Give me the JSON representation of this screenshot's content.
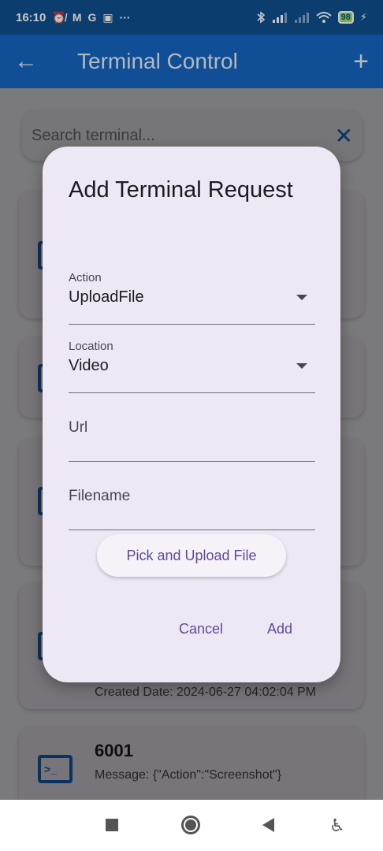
{
  "status_bar": {
    "time": "16:10",
    "left_icons": [
      "alarm-off-icon",
      "gmail-icon",
      "google-icon",
      "usb-icon",
      "more-icon"
    ],
    "left_glyphs": [
      "⏰̸",
      "M",
      "G",
      "▣",
      "···"
    ],
    "right_icons": [
      "bluetooth-icon",
      "signal-icon",
      "signal-icon",
      "wifi-icon",
      "battery-icon",
      "charging-icon"
    ],
    "battery": "98"
  },
  "app_bar": {
    "title": "Terminal Control",
    "back_icon": "back-arrow-icon",
    "add_icon": "add-icon"
  },
  "search": {
    "placeholder": "Search terminal...",
    "clear_icon": "close-icon"
  },
  "cards": [
    {
      "name": "",
      "line1": "",
      "line2": ""
    },
    {
      "name": "",
      "line1": "",
      "line2": ""
    },
    {
      "name": "",
      "line1": "",
      "line2": ""
    },
    {
      "name": "",
      "line1": "",
      "line2": "Created Date: 2024-06-27 04:02:04 PM"
    },
    {
      "name": "6001",
      "line1": "Message: {\"Action\":\"Screenshot\"}",
      "line2": ""
    }
  ],
  "dialog": {
    "title": "Add Terminal Request",
    "action_label": "Action",
    "action_value": "UploadFile",
    "location_label": "Location",
    "location_value": "Video",
    "url_placeholder": "Url",
    "filename_placeholder": "Filename",
    "pick_button": "Pick and Upload File",
    "cancel_button": "Cancel",
    "add_button": "Add"
  },
  "nav_bar": {
    "icons": [
      "recents-icon",
      "home-icon",
      "back-icon",
      "accessibility-icon"
    ]
  },
  "colors": {
    "status_bar": "#0f4f8e",
    "app_bar": "#1565c0",
    "dialog_bg": "#eee8f4",
    "accent": "#5f4a97"
  }
}
